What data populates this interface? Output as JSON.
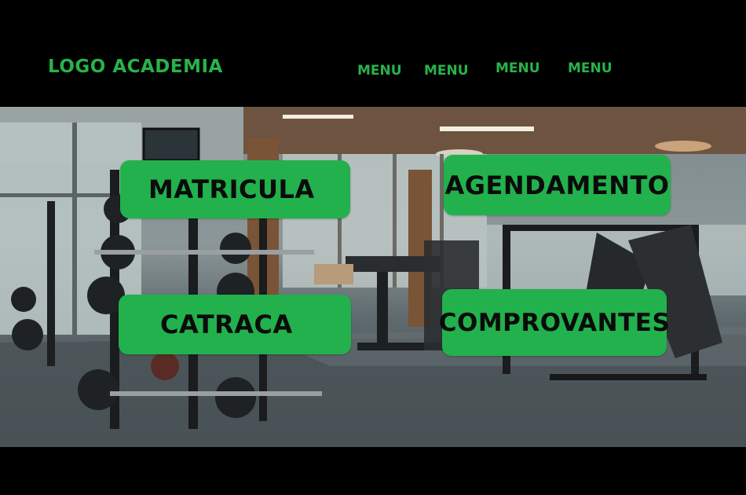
{
  "header": {
    "logo": "LOGO ACADEMIA",
    "menu": [
      "MENU",
      "MENU",
      "MENU",
      "MENU"
    ]
  },
  "hero": {
    "image": "gym-interior-photo"
  },
  "tiles": {
    "matricula": "MATRICULA",
    "agendamento": "AGENDAMENTO",
    "catraca": "CATRACA",
    "comprovantes": "COMPROVANTES"
  },
  "colors": {
    "brand_green": "#29b24a",
    "tile_green": "#22b14c",
    "background": "#000000"
  }
}
